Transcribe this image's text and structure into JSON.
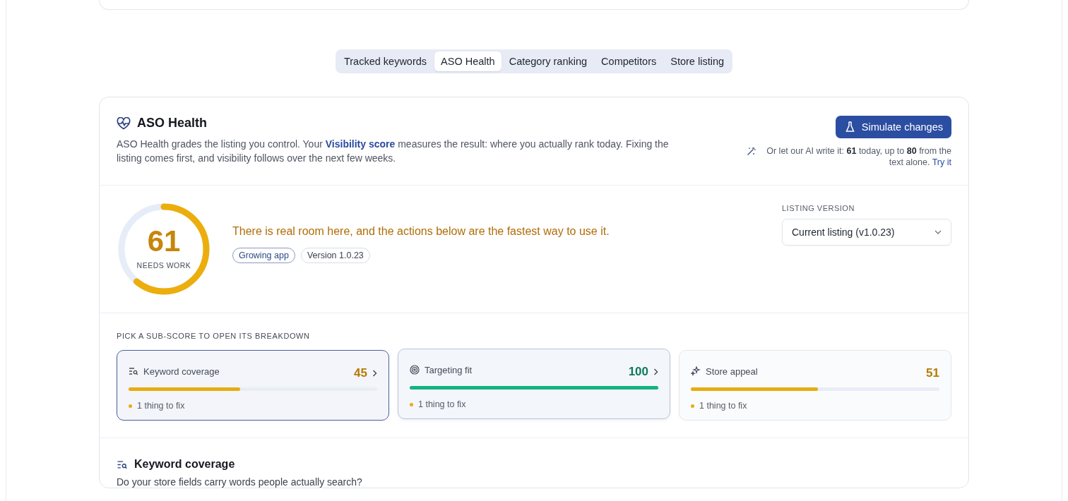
{
  "tabs": [
    {
      "label": "Tracked keywords",
      "selected": false
    },
    {
      "label": "ASO Health",
      "selected": true
    },
    {
      "label": "Category ranking",
      "selected": false
    },
    {
      "label": "Competitors",
      "selected": false
    },
    {
      "label": "Store listing",
      "selected": false
    }
  ],
  "health": {
    "title": "ASO Health",
    "description": "ASO Health grades the listing you control. Your **Visibility score** measures the result: where you actually rank today. Fixing the listing comes first, and visibility follows over the next few weeks.",
    "simulate_button": "Simulate changes",
    "ai_note": "Or let our AI write it: **61** today, up to **80** from the text alone.",
    "ai_link": "Try it"
  },
  "score": {
    "value": "61",
    "label": "NEEDS WORK",
    "level": 0.61,
    "message": "There is real room here, and the actions below are the fastest way to use it."
  },
  "tags": [
    {
      "label": "Growing app",
      "kind": "segment"
    },
    {
      "label": "Version 1.0.23",
      "kind": "version"
    }
  ],
  "listing_version": {
    "label": "LISTING VERSION",
    "value": "Current listing (v1.0.23)"
  },
  "subscores_heading": "PICK A SUB-SCORE TO OPEN ITS BREAKDOWN",
  "subscores": [
    {
      "kind": "keywords",
      "name": "Keyword coverage",
      "score": "45",
      "level": 0.45,
      "color": "#e8ac10",
      "note": "1 thing to fix",
      "selected": true,
      "hovered": false
    },
    {
      "kind": "targeting",
      "name": "Targeting fit",
      "score": "100",
      "level": 1,
      "color": "#13b37e",
      "note": "1 thing to fix",
      "selected": false,
      "hovered": true
    },
    {
      "kind": "appeal",
      "name": "Store appeal",
      "score": "51",
      "level": 0.51,
      "color": "#e8ac10",
      "note": "1 thing to fix",
      "selected": false,
      "hovered": false
    }
  ],
  "breakdown": {
    "title": "Keyword coverage",
    "question": "Do your store fields carry words people actually search?"
  }
}
